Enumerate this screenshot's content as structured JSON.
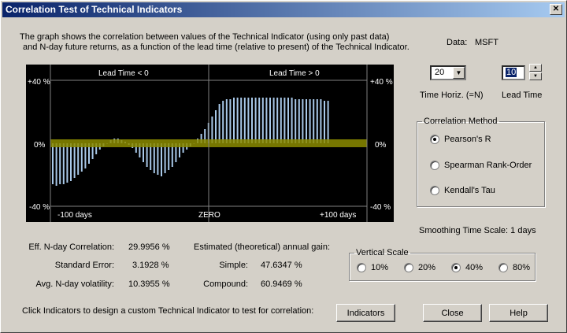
{
  "window": {
    "title": "Correlation Test of Technical Indicators",
    "close_glyph": "✕"
  },
  "description": {
    "line1": "The graph shows the correlation between values of the Technical Indicator (using only past data)",
    "line2": "and N-day future returns, as a function of the lead time (relative to present) of the Technical Indicator."
  },
  "data_label": "Data:",
  "data_value": "MSFT",
  "chart_data": {
    "type": "bar",
    "labels": {
      "left_header": "Lead Time < 0",
      "right_header": "Lead Time > 0",
      "y_top_left": "+40 %",
      "y_mid_left": "0%",
      "y_bot_left": "-40 %",
      "y_top_right": "+40 %",
      "y_mid_right": "0%",
      "y_bot_right": "-40 %",
      "x_left": "-100 days",
      "x_mid": "ZERO",
      "x_right": "+100 days"
    },
    "x_range": [
      -100,
      100
    ],
    "ylim": [
      -40,
      40
    ],
    "band_color": "#8b8b00",
    "bar_color": "#a8c8e8",
    "series": [
      {
        "values": [
          -26,
          -27,
          -26,
          -26,
          -25,
          -24,
          -22,
          -20,
          -18,
          -16,
          -13,
          -10,
          -7,
          -4,
          -2,
          0,
          2,
          3,
          3,
          2,
          1,
          -1,
          -3,
          -6,
          -9,
          -12,
          -15,
          -17,
          -19,
          -20,
          -21,
          -19,
          -17,
          -15,
          -12,
          -9,
          -6,
          -4,
          -2,
          0,
          3,
          6,
          9,
          13,
          17,
          21,
          25,
          27,
          28,
          28,
          29,
          29,
          29,
          29,
          29,
          29,
          29,
          29,
          29,
          29,
          29,
          29,
          29,
          29,
          29,
          29,
          29,
          28,
          28,
          28,
          28,
          28,
          28,
          28,
          28,
          27,
          27
        ]
      }
    ]
  },
  "time_horiz": {
    "value": "20",
    "label": "Time Horiz. (=N)"
  },
  "lead_time": {
    "value": "10",
    "label": "Lead Time"
  },
  "correlation_method": {
    "legend": "Correlation Method",
    "options": [
      "Pearson's R",
      "Spearman Rank-Order",
      "Kendall's Tau"
    ],
    "selected": 0
  },
  "smoothing": "Smoothing Time Scale:  1 days",
  "vertical_scale": {
    "legend": "Vertical Scale",
    "options": [
      "10%",
      "20%",
      "40%",
      "80%"
    ],
    "selected": 2
  },
  "stats": {
    "eff_label": "Eff. N-day Correlation:",
    "eff_value": "29.9956 %",
    "stderr_label": "Standard Error:",
    "stderr_value": "3.1928 %",
    "vol_label": "Avg. N-day volatility:",
    "vol_value": "10.3955 %",
    "gain_heading": "Estimated (theoretical) annual gain:",
    "simple_label": "Simple:",
    "simple_value": "47.6347 %",
    "compound_label": "Compound:",
    "compound_value": "60.9469 %"
  },
  "footer_text": "Click Indicators to design a custom Technical Indicator to test for correlation:",
  "buttons": {
    "indicators": "Indicators",
    "close": "Close",
    "help": "Help"
  }
}
